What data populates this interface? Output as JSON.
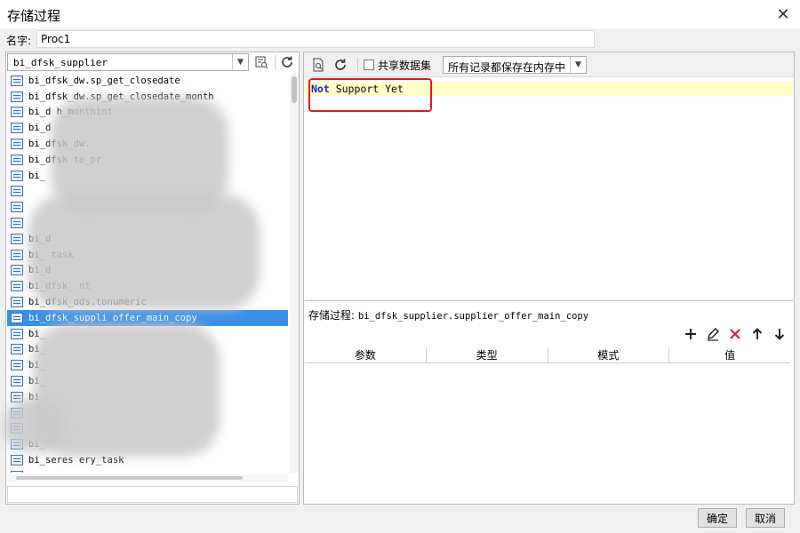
{
  "window": {
    "title": "存储过程"
  },
  "name_field": {
    "label": "名字:",
    "value": "Proc1"
  },
  "left": {
    "schema": "bi_dfsk_supplier",
    "procedures": [
      "bi_dfsk_dw.sp_get_closedate",
      "bi_dfsk_dw.sp_get_closedate_month",
      "bi_d                          h_monthint",
      "bi_d",
      "bi_dfsk_dw.",
      "bi_dfsk                                te_pr",
      "bi_",
      "",
      "",
      "",
      "bi_d",
      "bi_                        task",
      "bi_d",
      "bi_dfsk_         nt",
      "bi_dfsk_ods.tonumeric",
      "bi_dfsk_suppli        offer_main_copy",
      "bi_",
      "bi_",
      "bi_",
      "bi_",
      "bi_",
      "",
      "",
      "bi_",
      "bi_seres                     ery_task",
      ""
    ],
    "selected_index": 15,
    "filter_value": ""
  },
  "right": {
    "toolbar": {
      "share_label": "共享数据集",
      "mode_value": "所有记录都保存在内存中"
    },
    "code": {
      "keyword": "Not",
      "rest": " Support Yet"
    },
    "proc_path": {
      "label": "存储过程:",
      "value": "bi_dfsk_supplier.supplier_offer_main_copy"
    },
    "columns": [
      "参数",
      "类型",
      "模式",
      "值"
    ]
  },
  "footer": {
    "ok": "确定",
    "cancel": "取消"
  },
  "colors": {
    "selection": "#3b8fe8",
    "highlight_box": "#e8161c",
    "code_bg": "#ffffc6",
    "keyword": "#1c1ccc"
  }
}
